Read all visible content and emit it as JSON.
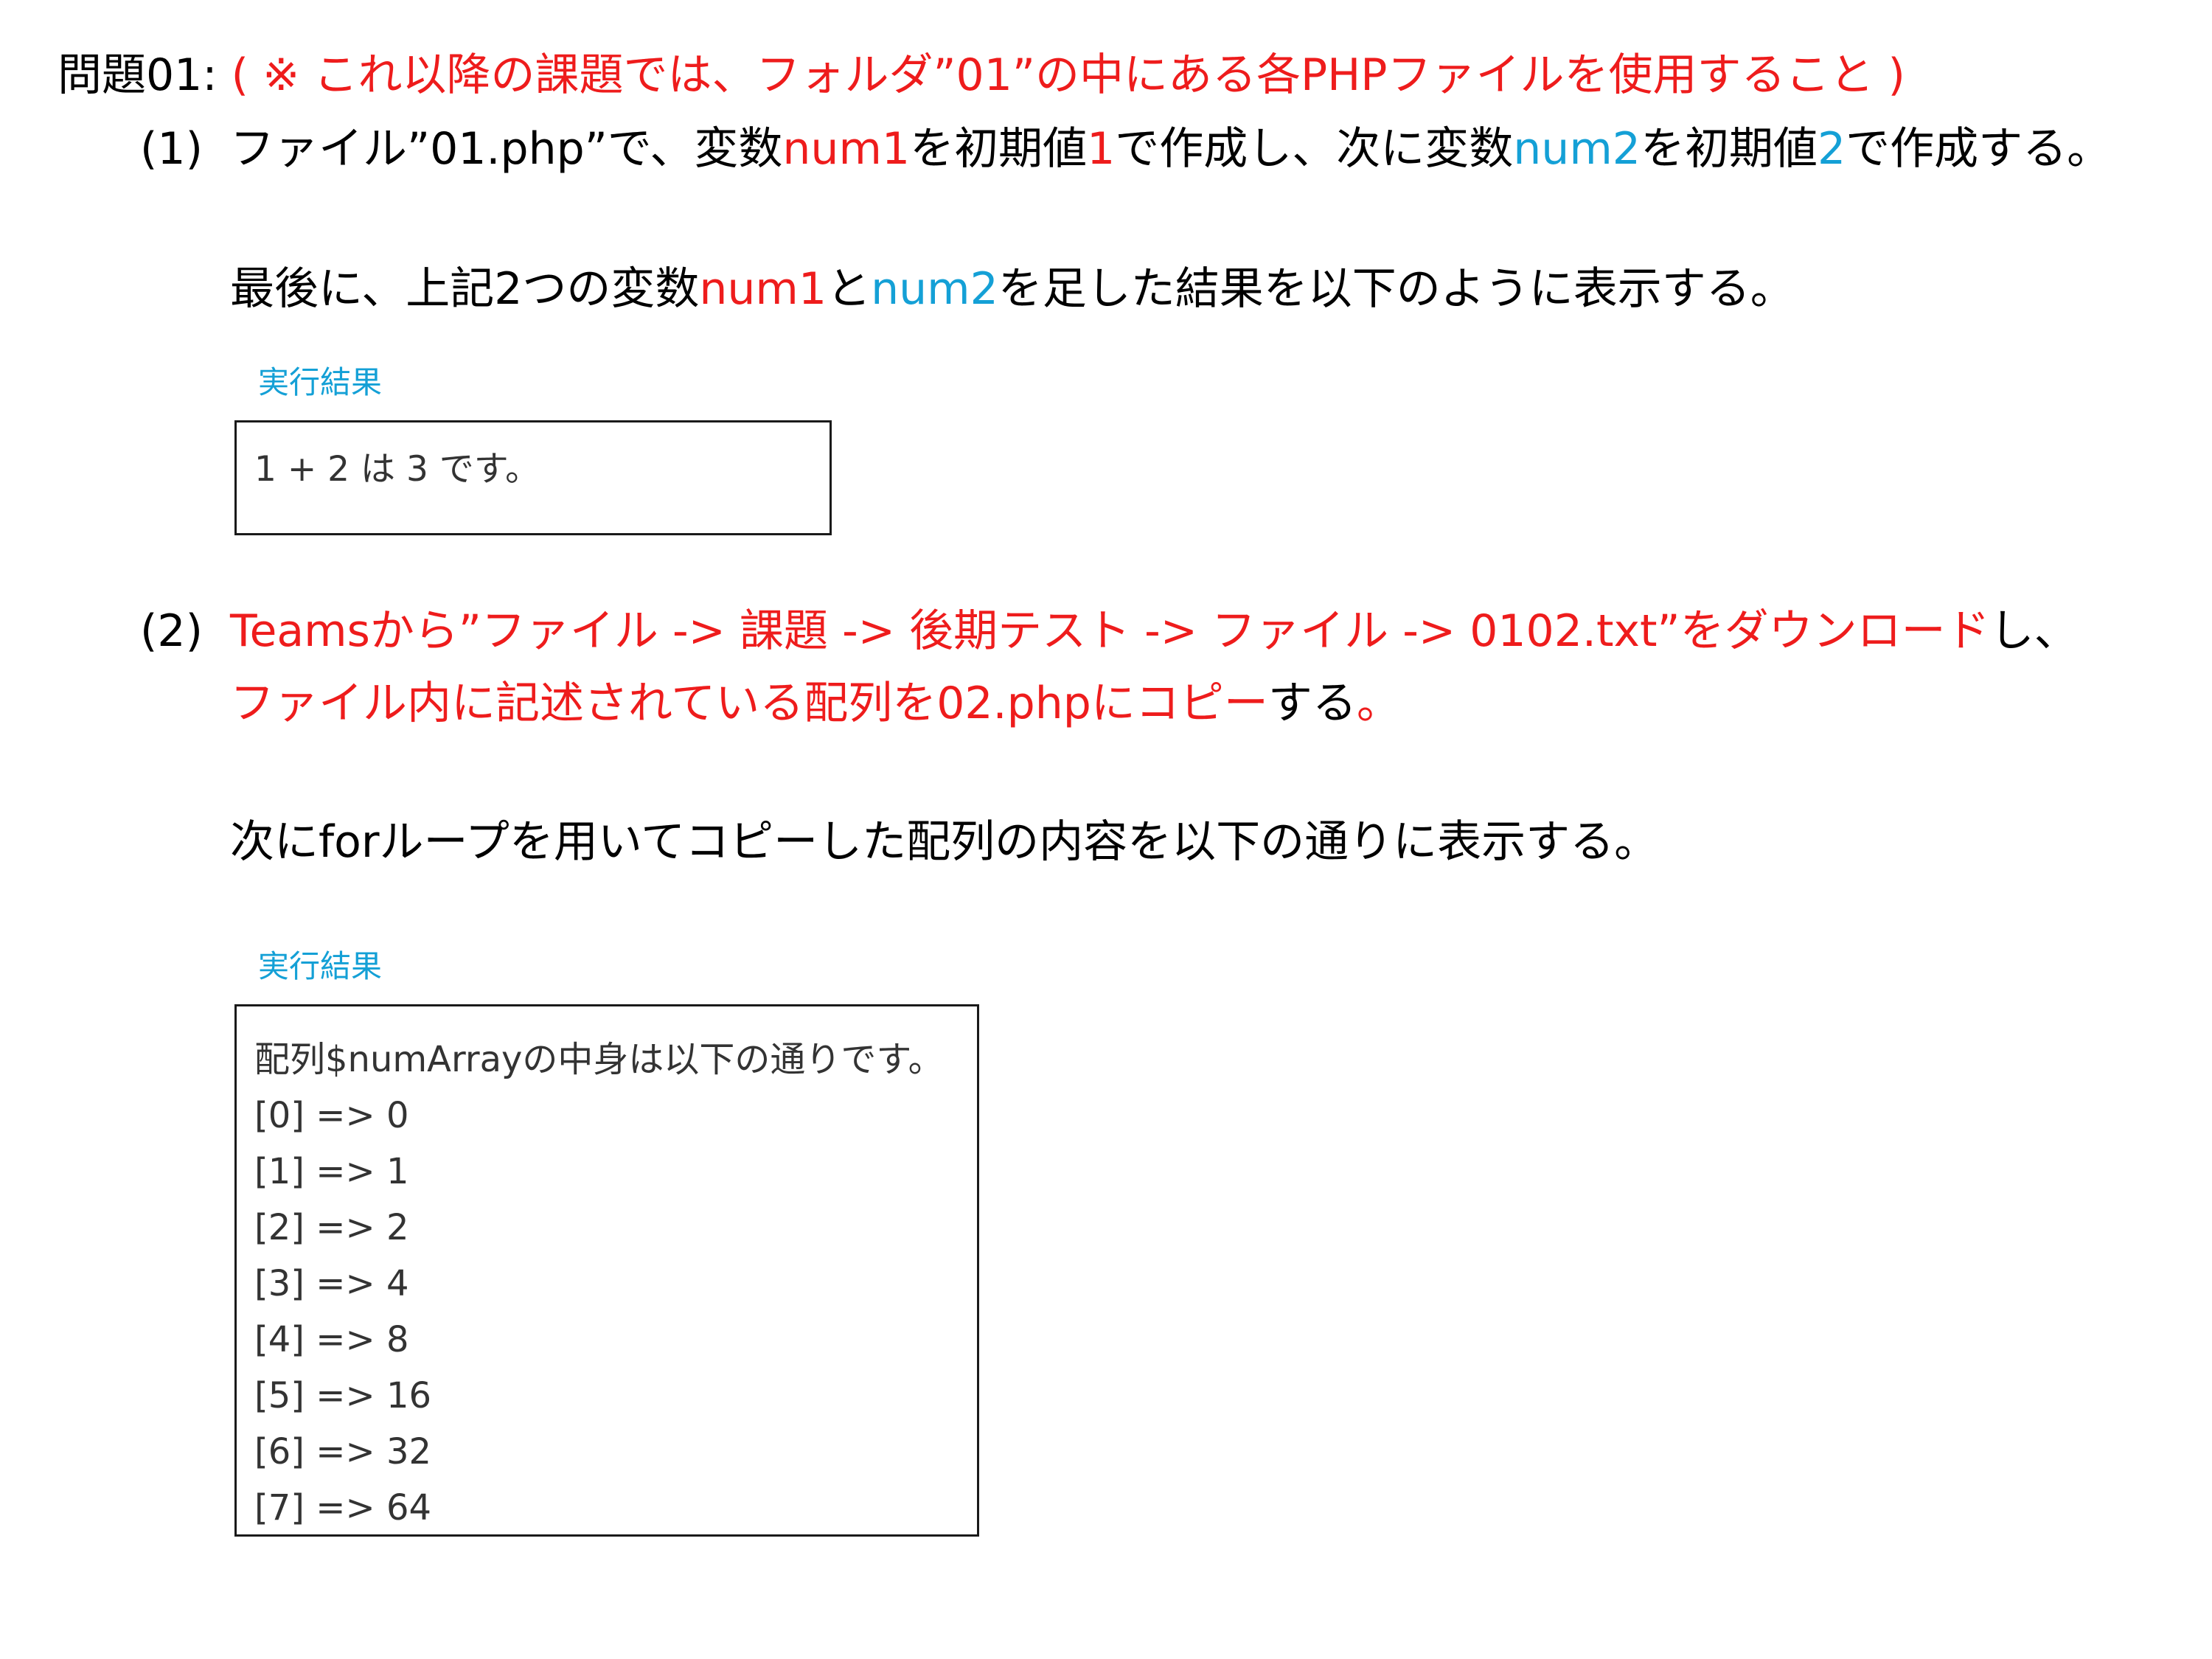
{
  "heading": {
    "title": "問題01:",
    "note": "( ※ これ以降の課題では、フォルダ”01”の中にある各PHPファイルを使用すること )"
  },
  "q1": {
    "number": "(1)",
    "line1": [
      "ファイル”01.php”で、変数",
      "num1",
      "を初期値",
      "1",
      "で作成し、次に変数",
      "num2",
      "を初期値",
      "2",
      "で作成する。"
    ],
    "line2": [
      "最後に、上記2つの変数",
      "num1",
      "と",
      "num2",
      "を足した結果を以下のように表示する。"
    ],
    "result_label": "実行結果",
    "result_text": "1 + 2 は 3 です。"
  },
  "q2": {
    "number": "(2)",
    "line1_red": "Teamsから”ファイル -> 課題 -> 後期テスト -> ファイル -> 0102.txt”をダウンロード",
    "line1_black": "し、",
    "line2_red_a": "ファイル内に記述されている配列を02.phpにコピー",
    "line2_black": "する",
    "line2_red_b": "。",
    "line3": "次にforループを用いてコピーした配列の内容を以下の通りに表示する。",
    "result_label": "実行結果",
    "result_lines": [
      "配列$numArrayの中身は以下の通りです。",
      "[0] => 0",
      "[1] => 1",
      "[2] => 2",
      "[3] => 4",
      "[4] => 8",
      "[5] => 16",
      "[6] => 32",
      "[7] => 64"
    ]
  },
  "colors": {
    "red": "#ee1c1c",
    "blue": "#14a0d6",
    "text": "#000000"
  }
}
